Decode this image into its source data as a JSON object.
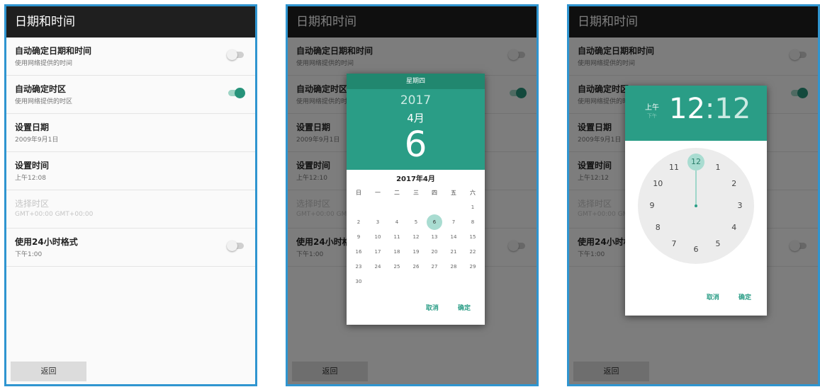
{
  "app": {
    "title": "日期和时间",
    "back_label": "返回",
    "settings": [
      {
        "title": "自动确定日期和时间",
        "subtitle": "使用网络提供的时间",
        "toggle": "off"
      },
      {
        "title": "自动确定时区",
        "subtitle": "使用网络提供的时区",
        "toggle": "on"
      },
      {
        "title": "设置日期",
        "subtitle": "2009年9月1日"
      },
      {
        "title": "设置时间",
        "subtitle": "上午12:08"
      },
      {
        "title": "选择时区",
        "subtitle": "GMT+00:00 GMT+00:00",
        "disabled": true
      },
      {
        "title": "使用24小时格式",
        "subtitle": "下午1:00",
        "toggle": "off"
      }
    ]
  },
  "panel2": {
    "time_subtitle": "上午12:10",
    "date_picker": {
      "weekday": "星期四",
      "year": "2017",
      "month": "4月",
      "day": "6",
      "month_title": "2017年4月",
      "weekdays": [
        "日",
        "一",
        "二",
        "三",
        "四",
        "五",
        "六"
      ],
      "days": [
        "1",
        "2",
        "3",
        "4",
        "5",
        "6",
        "7",
        "8",
        "9",
        "10",
        "11",
        "12",
        "13",
        "14",
        "15",
        "16",
        "17",
        "18",
        "19",
        "20",
        "21",
        "22",
        "23",
        "24",
        "25",
        "26",
        "27",
        "28",
        "29",
        "30"
      ],
      "selected_day": "6",
      "cancel": "取消",
      "ok": "确定"
    }
  },
  "panel3": {
    "time_subtitle": "上午12:12",
    "time_picker": {
      "am_label": "上午",
      "pm_label": "下午",
      "hour": "12",
      "colon": ":",
      "minute": "12",
      "clock_numbers": [
        "12",
        "1",
        "2",
        "3",
        "4",
        "5",
        "6",
        "7",
        "8",
        "9",
        "10",
        "11"
      ],
      "selected": "12",
      "cancel": "取消",
      "ok": "确定"
    }
  },
  "colors": {
    "accent": "#2a9d86",
    "accent_dark": "#21876f",
    "frame": "#2f95d0",
    "header": "#1f1f1f"
  }
}
